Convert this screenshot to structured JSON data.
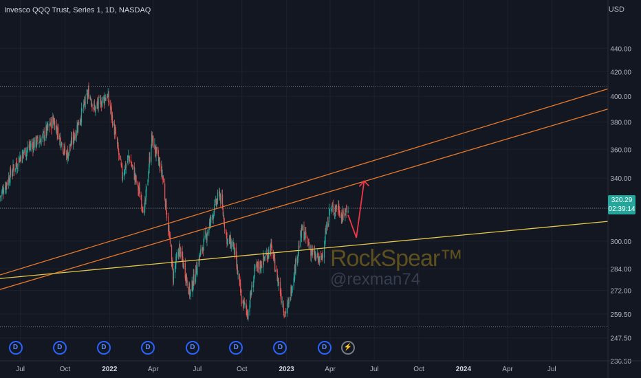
{
  "chart_data": {
    "type": "candlestick",
    "title": "Invesco QQQ Trust, Series 1, 1D, NASDAQ",
    "currency": "USD",
    "y_scale": "log",
    "ylim": [
      236.5,
      470
    ],
    "y_ticks": [
      "236.50",
      "247.50",
      "259.50",
      "272.00",
      "284.00",
      "300.00",
      "320.00",
      "340.00",
      "360.00",
      "380.00",
      "400.00",
      "420.00",
      "440.00"
    ],
    "x_ticks": [
      {
        "date": "2021-07-01",
        "label": "Jul"
      },
      {
        "date": "2021-10-01",
        "label": "Oct"
      },
      {
        "date": "2022-01-01",
        "label": "2022"
      },
      {
        "date": "2022-04-01",
        "label": "Apr"
      },
      {
        "date": "2022-07-01",
        "label": "Jul"
      },
      {
        "date": "2022-10-01",
        "label": "Oct"
      },
      {
        "date": "2023-01-01",
        "label": "2023"
      },
      {
        "date": "2023-04-01",
        "label": "Apr"
      },
      {
        "date": "2023-07-01",
        "label": "Jul"
      },
      {
        "date": "2023-10-01",
        "label": "Oct"
      },
      {
        "date": "2024-01-01",
        "label": "2024"
      },
      {
        "date": "2024-04-01",
        "label": "Apr"
      },
      {
        "date": "2024-07-01",
        "label": "Jul"
      }
    ],
    "x_range": [
      "2021-05-20",
      "2024-10-25"
    ],
    "price_path": [
      [
        "2021-05-20",
        328
      ],
      [
        "2021-06-10",
        342
      ],
      [
        "2021-07-01",
        355
      ],
      [
        "2021-07-20",
        362
      ],
      [
        "2021-08-15",
        368
      ],
      [
        "2021-09-07",
        382
      ],
      [
        "2021-10-04",
        355
      ],
      [
        "2021-10-22",
        372
      ],
      [
        "2021-11-19",
        403
      ],
      [
        "2021-12-01",
        390
      ],
      [
        "2021-12-27",
        401
      ],
      [
        "2022-01-05",
        386
      ],
      [
        "2022-01-27",
        342
      ],
      [
        "2022-02-10",
        355
      ],
      [
        "2022-03-14",
        318
      ],
      [
        "2022-03-29",
        368
      ],
      [
        "2022-04-20",
        342
      ],
      [
        "2022-05-12",
        280
      ],
      [
        "2022-05-25",
        296
      ],
      [
        "2022-06-16",
        270
      ],
      [
        "2022-07-05",
        290
      ],
      [
        "2022-08-16",
        330
      ],
      [
        "2022-09-01",
        300
      ],
      [
        "2022-09-13",
        298
      ],
      [
        "2022-09-30",
        267
      ],
      [
        "2022-10-13",
        260
      ],
      [
        "2022-10-28",
        283
      ],
      [
        "2022-11-10",
        287
      ],
      [
        "2022-11-30",
        296
      ],
      [
        "2022-12-28",
        260
      ],
      [
        "2023-01-05",
        264
      ],
      [
        "2023-02-02",
        307
      ],
      [
        "2023-02-24",
        292
      ],
      [
        "2023-03-13",
        288
      ],
      [
        "2023-03-31",
        319
      ],
      [
        "2023-04-18",
        321
      ],
      [
        "2023-04-26",
        314
      ],
      [
        "2023-05-08",
        322
      ]
    ],
    "horizontal_levels": [
      {
        "price": 408,
        "style": "dotted"
      },
      {
        "price": 320.29,
        "style": "dotted"
      },
      {
        "price": 253,
        "style": "dotted"
      }
    ],
    "trend_lines": [
      {
        "color": "#e8792b",
        "points": [
          [
            "2021-05-20",
            280.5
          ],
          [
            "2024-10-25",
            406
          ]
        ]
      },
      {
        "color": "#e8792b",
        "points": [
          [
            "2021-05-20",
            272.5
          ],
          [
            "2024-10-25",
            390
          ]
        ]
      },
      {
        "color": "#e6c84b",
        "points": [
          [
            "2021-05-20",
            278.5
          ],
          [
            "2024-10-25",
            312
          ]
        ]
      }
    ],
    "projection_arrow": {
      "color": "#f23645",
      "points": [
        [
          "2023-05-08",
          316
        ],
        [
          "2023-05-25",
          302
        ],
        [
          "2023-06-10",
          338
        ]
      ]
    },
    "last_price": "320.29",
    "countdown": "02:39:14",
    "event_markers": [
      {
        "date": "2021-06-21",
        "symbol": "D"
      },
      {
        "date": "2021-09-20",
        "symbol": "D"
      },
      {
        "date": "2021-12-20",
        "symbol": "D"
      },
      {
        "date": "2022-03-21",
        "symbol": "D"
      },
      {
        "date": "2022-06-21",
        "symbol": "D"
      },
      {
        "date": "2022-09-19",
        "symbol": "D"
      },
      {
        "date": "2022-12-19",
        "symbol": "D"
      },
      {
        "date": "2023-03-20",
        "symbol": "D"
      },
      {
        "date": "2023-05-08",
        "symbol": "⚡"
      }
    ],
    "colors": {
      "up": "#26a69a",
      "down": "#ef5350",
      "background": "#131722",
      "grid": "#1e222d",
      "text": "#b2b5be"
    }
  },
  "watermark": {
    "main": "RockSpear™",
    "handle": "@rexman74"
  }
}
